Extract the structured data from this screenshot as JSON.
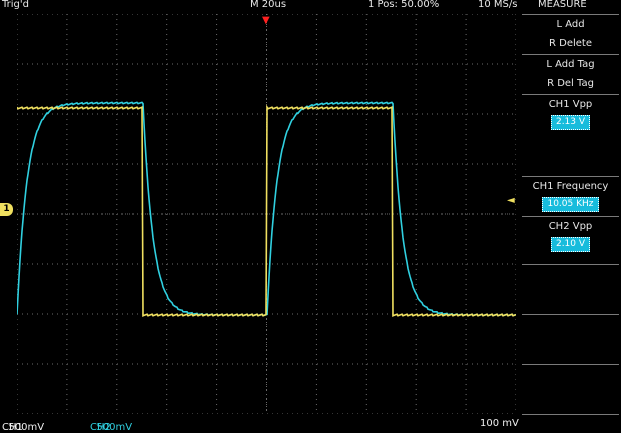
{
  "header": {
    "trigger_status": "Trig'd",
    "timebase": "M 20us",
    "trigger_position": "1 Pos: 50.00%",
    "sample_rate": "10 MS/s",
    "menu_title": "MEASURE"
  },
  "channels": {
    "ch1": {
      "label": "CH1",
      "scale": "500mV",
      "color": "#f0e060"
    },
    "ch2": {
      "label": "CH2",
      "scale": "500mV",
      "color": "#30d0e0"
    },
    "horizontal_scale": "100 mV"
  },
  "markers": {
    "ch1_ground": "1",
    "trigger_level": "◄",
    "trigger_time": "▼"
  },
  "measure_menu": [
    {
      "line1": "L Add",
      "line2": "R Delete"
    },
    {
      "line1": "L Add Tag",
      "line2": "R Del Tag"
    },
    {
      "line1": "CH1 Vpp",
      "value": "2.13 V"
    },
    {
      "line1": "",
      "value": ""
    },
    {
      "line1": "CH1 Frequency",
      "value": "10.05 KHz"
    },
    {
      "line1": "CH2 Vpp",
      "value": "2.10 V"
    },
    {
      "line1": ""
    },
    {
      "line1": ""
    },
    {
      "line1": ""
    }
  ],
  "colors": {
    "background": "#000000",
    "grid": "#6a6a6a",
    "ch1_trace": "#f0e060",
    "ch2_trace": "#30d0e0",
    "value_highlight": "#17bcdc"
  }
}
